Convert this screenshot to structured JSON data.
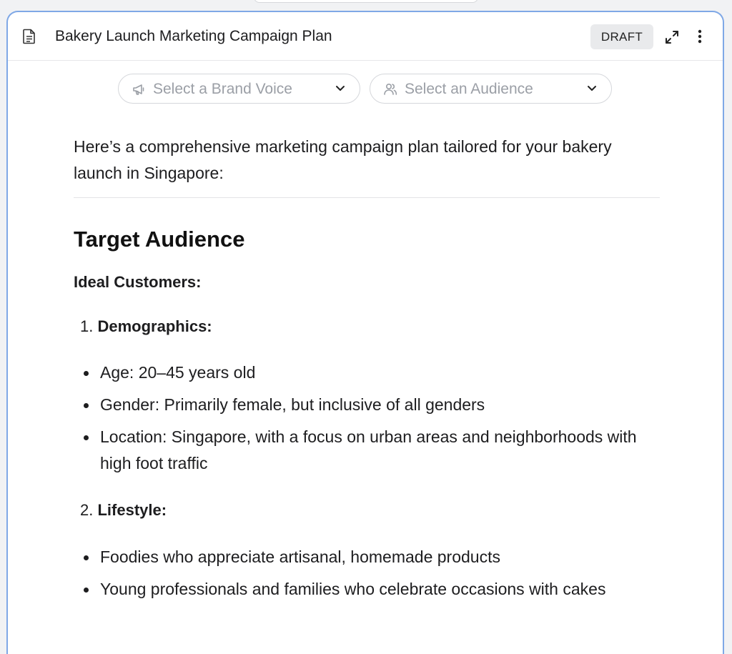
{
  "header": {
    "title": "Bakery Launch Marketing Campaign Plan",
    "badge": "DRAFT",
    "doc_icon": "document-icon",
    "expand_icon": "expand-icon",
    "more_icon": "more-vertical-icon"
  },
  "selectors": {
    "brand_voice": {
      "placeholder": "Select a Brand Voice",
      "icon": "megaphone-icon"
    },
    "audience": {
      "placeholder": "Select an Audience",
      "icon": "users-icon"
    }
  },
  "content": {
    "intro": "Here’s a comprehensive marketing campaign plan tailored for your bakery launch in Singapore:",
    "heading": "Target Audience",
    "subheading": "Ideal Customers:",
    "sections": [
      {
        "number": "1.",
        "title": "Demographics:",
        "bullets": [
          "Age: 20–45 years old",
          "Gender: Primarily female, but inclusive of all genders",
          "Location: Singapore, with a focus on urban areas and neighborhoods with high foot traffic"
        ]
      },
      {
        "number": "2.",
        "title": "Lifestyle:",
        "bullets": [
          "Foodies who appreciate artisanal, homemade products",
          "Young professionals and families who celebrate occasions with cakes"
        ]
      }
    ]
  },
  "colors": {
    "panel_border": "#7fa8e6",
    "badge_bg": "#e9eaec",
    "placeholder_text": "#9b9fa6"
  }
}
